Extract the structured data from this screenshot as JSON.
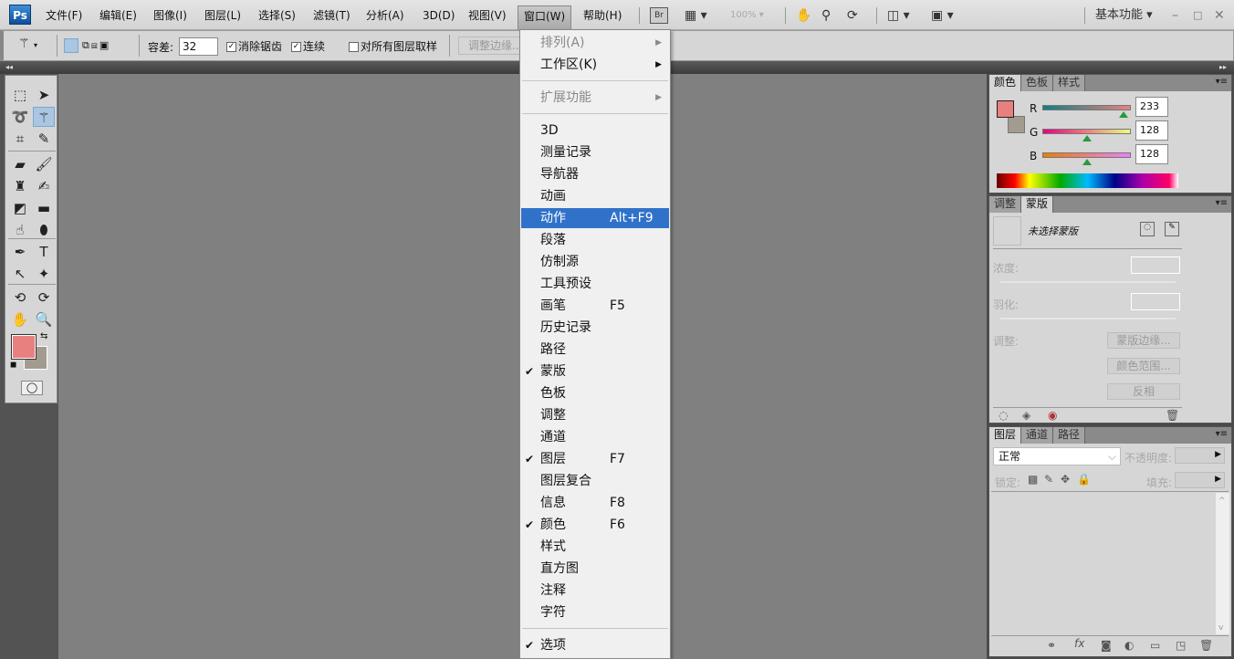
{
  "app": {
    "logo": "Ps"
  },
  "menubar": {
    "items": [
      "文件(F)",
      "编辑(E)",
      "图像(I)",
      "图层(L)",
      "选择(S)",
      "滤镜(T)",
      "分析(A)",
      "3D(D)",
      "视图(V)",
      "窗口(W)",
      "帮助(H)"
    ],
    "active_index": 9,
    "bridge": "Br",
    "zoom": "100%",
    "workspace": "基本功能"
  },
  "options": {
    "tolerance_label": "容差:",
    "tolerance_value": "32",
    "anti_alias": "消除锯齿",
    "anti_alias_checked": true,
    "contiguous": "连续",
    "contiguous_checked": true,
    "sample_all": "对所有图层取样",
    "sample_all_checked": false,
    "refine_edge": "调整边缘..."
  },
  "colors": {
    "foreground": "#e88080",
    "background": "#a39b90",
    "accent": "#3072c9"
  },
  "color_panel": {
    "tabs": [
      "颜色",
      "色板",
      "样式"
    ],
    "channels": [
      {
        "name": "R",
        "value": "233",
        "fraction": 0.914
      },
      {
        "name": "G",
        "value": "128",
        "fraction": 0.502
      },
      {
        "name": "B",
        "value": "128",
        "fraction": 0.502
      }
    ]
  },
  "mask_panel": {
    "tabs": [
      "调整",
      "蒙版"
    ],
    "status": "未选择蒙版",
    "density": "浓度:",
    "feather": "羽化:",
    "refine": "调整:",
    "buttons": [
      "蒙版边缘...",
      "颜色范围...",
      "反相"
    ]
  },
  "layers_panel": {
    "tabs": [
      "图层",
      "通道",
      "路径"
    ],
    "blend_mode": "正常",
    "opacity_label": "不透明度:",
    "lock_label": "锁定:",
    "fill_label": "填充:"
  },
  "window_menu": {
    "items": [
      {
        "label": "排列(A)",
        "disabled": true,
        "submenu": true
      },
      {
        "label": "工作区(K)",
        "submenu": true
      },
      {
        "sep": true
      },
      {
        "label": "扩展功能",
        "disabled": true,
        "submenu": true
      },
      {
        "sep": true
      },
      {
        "label": "3D"
      },
      {
        "label": "测量记录"
      },
      {
        "label": "导航器"
      },
      {
        "label": "动画"
      },
      {
        "label": "动作",
        "shortcut": "Alt+F9",
        "highlighted": true
      },
      {
        "label": "段落"
      },
      {
        "label": "仿制源"
      },
      {
        "label": "工具预设"
      },
      {
        "label": "画笔",
        "shortcut": "F5"
      },
      {
        "label": "历史记录"
      },
      {
        "label": "路径"
      },
      {
        "label": "蒙版",
        "checked": true
      },
      {
        "label": "色板"
      },
      {
        "label": "调整"
      },
      {
        "label": "通道"
      },
      {
        "label": "图层",
        "shortcut": "F7",
        "checked": true
      },
      {
        "label": "图层复合"
      },
      {
        "label": "信息",
        "shortcut": "F8"
      },
      {
        "label": "颜色",
        "shortcut": "F6",
        "checked": true
      },
      {
        "label": "样式"
      },
      {
        "label": "直方图"
      },
      {
        "label": "注释"
      },
      {
        "label": "字符"
      },
      {
        "sep": true
      },
      {
        "label": "选项",
        "checked": true
      }
    ]
  },
  "tools": [
    {
      "name": "marquee",
      "glyph": "⬚"
    },
    {
      "name": "move",
      "glyph": "➤"
    },
    {
      "name": "lasso",
      "glyph": "➰"
    },
    {
      "name": "magic-wand",
      "glyph": "⚚",
      "selected": true
    },
    {
      "name": "crop",
      "glyph": "⌗"
    },
    {
      "name": "eyedropper",
      "glyph": "✎"
    },
    {
      "name": "healing",
      "glyph": "▰"
    },
    {
      "name": "brush",
      "glyph": "🖌"
    },
    {
      "name": "stamp",
      "glyph": "♜"
    },
    {
      "name": "history-brush",
      "glyph": "✍"
    },
    {
      "name": "eraser",
      "glyph": "◩"
    },
    {
      "name": "gradient",
      "glyph": "▬"
    },
    {
      "name": "smudge",
      "glyph": "☝"
    },
    {
      "name": "dodge",
      "glyph": "⬮"
    },
    {
      "name": "pen",
      "glyph": "✒"
    },
    {
      "name": "type",
      "glyph": "T"
    },
    {
      "name": "path-select",
      "glyph": "↖"
    },
    {
      "name": "shape",
      "glyph": "✦"
    },
    {
      "name": "3d-rotate",
      "glyph": "⟲"
    },
    {
      "name": "3d-orbit",
      "glyph": "⟳"
    },
    {
      "name": "hand",
      "glyph": "✋"
    },
    {
      "name": "zoom",
      "glyph": "🔍"
    }
  ]
}
